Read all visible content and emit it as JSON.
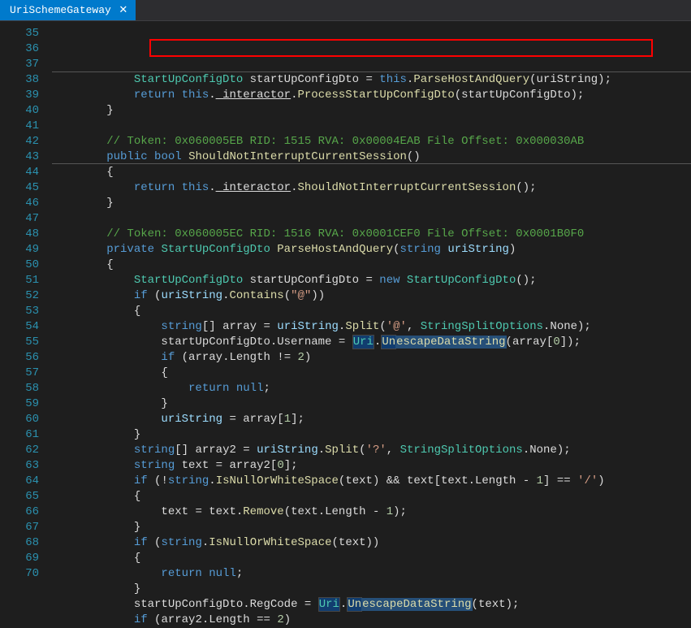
{
  "tab": {
    "title": "UriSchemeGateway",
    "close_glyph": "✕"
  },
  "lines": [
    {
      "n": 35,
      "segs": [
        {
          "t": "            ",
          "c": ""
        },
        {
          "t": "StartUpConfigDto",
          "c": "type"
        },
        {
          "t": " ",
          "c": ""
        },
        {
          "t": "startUpConfigDto",
          "c": "ident"
        },
        {
          "t": " ",
          "c": ""
        },
        {
          "t": "=",
          "c": "op"
        },
        {
          "t": " ",
          "c": ""
        },
        {
          "t": "this",
          "c": "kw"
        },
        {
          "t": ".",
          "c": "punc"
        },
        {
          "t": "ParseHostAndQuery",
          "c": "method-call"
        },
        {
          "t": "(",
          "c": "punc"
        },
        {
          "t": "uriString",
          "c": "ident"
        },
        {
          "t": ");",
          "c": "punc"
        }
      ]
    },
    {
      "n": 36,
      "segs": [
        {
          "t": "            ",
          "c": ""
        },
        {
          "t": "return",
          "c": "kw"
        },
        {
          "t": " ",
          "c": ""
        },
        {
          "t": "this",
          "c": "kw"
        },
        {
          "t": ".",
          "c": "punc"
        },
        {
          "t": "_interactor",
          "c": "field underline"
        },
        {
          "t": ".",
          "c": "punc"
        },
        {
          "t": "ProcessStartUpConfigDto",
          "c": "method-call"
        },
        {
          "t": "(",
          "c": "punc"
        },
        {
          "t": "startUpConfigDto",
          "c": "ident"
        },
        {
          "t": ");",
          "c": "punc"
        }
      ]
    },
    {
      "n": 37,
      "segs": [
        {
          "t": "        }",
          "c": "punc"
        }
      ]
    },
    {
      "n": 38,
      "segs": []
    },
    {
      "n": 39,
      "segs": [
        {
          "t": "        ",
          "c": ""
        },
        {
          "t": "// Token: 0x060005EB RID: 1515 RVA: 0x00004EAB File Offset: 0x000030AB",
          "c": "comment"
        }
      ]
    },
    {
      "n": 40,
      "segs": [
        {
          "t": "        ",
          "c": ""
        },
        {
          "t": "public",
          "c": "kw"
        },
        {
          "t": " ",
          "c": ""
        },
        {
          "t": "bool",
          "c": "kw"
        },
        {
          "t": " ",
          "c": ""
        },
        {
          "t": "ShouldNotInterruptCurrentSession",
          "c": "method-decl"
        },
        {
          "t": "()",
          "c": "punc"
        }
      ]
    },
    {
      "n": 41,
      "segs": [
        {
          "t": "        {",
          "c": "punc"
        }
      ]
    },
    {
      "n": 42,
      "segs": [
        {
          "t": "            ",
          "c": ""
        },
        {
          "t": "return",
          "c": "kw"
        },
        {
          "t": " ",
          "c": ""
        },
        {
          "t": "this",
          "c": "kw"
        },
        {
          "t": ".",
          "c": "punc"
        },
        {
          "t": "_interactor",
          "c": "field underline"
        },
        {
          "t": ".",
          "c": "punc"
        },
        {
          "t": "ShouldNotInterruptCurrentSession",
          "c": "method-call"
        },
        {
          "t": "();",
          "c": "punc"
        }
      ]
    },
    {
      "n": 43,
      "segs": [
        {
          "t": "        }",
          "c": "punc"
        }
      ]
    },
    {
      "n": 44,
      "segs": []
    },
    {
      "n": 45,
      "segs": [
        {
          "t": "        ",
          "c": ""
        },
        {
          "t": "// Token: 0x060005EC RID: 1516 RVA: 0x0001CEF0 File Offset: 0x0001B0F0",
          "c": "comment"
        }
      ]
    },
    {
      "n": 46,
      "segs": [
        {
          "t": "        ",
          "c": ""
        },
        {
          "t": "private",
          "c": "kw"
        },
        {
          "t": " ",
          "c": ""
        },
        {
          "t": "StartUpConfigDto",
          "c": "type"
        },
        {
          "t": " ",
          "c": ""
        },
        {
          "t": "ParseHostAndQuery",
          "c": "method-decl"
        },
        {
          "t": "(",
          "c": "punc"
        },
        {
          "t": "string",
          "c": "kw"
        },
        {
          "t": " ",
          "c": ""
        },
        {
          "t": "uriString",
          "c": "param"
        },
        {
          "t": ")",
          "c": "punc"
        }
      ]
    },
    {
      "n": 47,
      "segs": [
        {
          "t": "        {",
          "c": "punc"
        }
      ]
    },
    {
      "n": 48,
      "segs": [
        {
          "t": "            ",
          "c": ""
        },
        {
          "t": "StartUpConfigDto",
          "c": "type"
        },
        {
          "t": " ",
          "c": ""
        },
        {
          "t": "startUpConfigDto",
          "c": "ident"
        },
        {
          "t": " ",
          "c": ""
        },
        {
          "t": "=",
          "c": "op"
        },
        {
          "t": " ",
          "c": ""
        },
        {
          "t": "new",
          "c": "kw"
        },
        {
          "t": " ",
          "c": ""
        },
        {
          "t": "StartUpConfigDto",
          "c": "type"
        },
        {
          "t": "();",
          "c": "punc"
        }
      ]
    },
    {
      "n": 49,
      "segs": [
        {
          "t": "            ",
          "c": ""
        },
        {
          "t": "if",
          "c": "kw"
        },
        {
          "t": " (",
          "c": "punc"
        },
        {
          "t": "uriString",
          "c": "param"
        },
        {
          "t": ".",
          "c": "punc"
        },
        {
          "t": "Contains",
          "c": "method-call"
        },
        {
          "t": "(",
          "c": "punc"
        },
        {
          "t": "\"@\"",
          "c": "string"
        },
        {
          "t": "))",
          "c": "punc"
        }
      ]
    },
    {
      "n": 50,
      "segs": [
        {
          "t": "            {",
          "c": "punc"
        }
      ]
    },
    {
      "n": 51,
      "segs": [
        {
          "t": "                ",
          "c": ""
        },
        {
          "t": "string",
          "c": "kw"
        },
        {
          "t": "[] ",
          "c": "punc"
        },
        {
          "t": "array",
          "c": "ident"
        },
        {
          "t": " ",
          "c": ""
        },
        {
          "t": "=",
          "c": "op"
        },
        {
          "t": " ",
          "c": ""
        },
        {
          "t": "uriString",
          "c": "param"
        },
        {
          "t": ".",
          "c": "punc"
        },
        {
          "t": "Split",
          "c": "method-call"
        },
        {
          "t": "(",
          "c": "punc"
        },
        {
          "t": "'@'",
          "c": "string"
        },
        {
          "t": ", ",
          "c": "punc"
        },
        {
          "t": "StringSplitOptions",
          "c": "type"
        },
        {
          "t": ".",
          "c": "punc"
        },
        {
          "t": "None",
          "c": "ident"
        },
        {
          "t": ");",
          "c": "punc"
        }
      ]
    },
    {
      "n": 52,
      "segs": [
        {
          "t": "                ",
          "c": ""
        },
        {
          "t": "startUpConfigDto",
          "c": "ident"
        },
        {
          "t": ".",
          "c": "punc"
        },
        {
          "t": "Username",
          "c": "ident"
        },
        {
          "t": " ",
          "c": ""
        },
        {
          "t": "=",
          "c": "op"
        },
        {
          "t": " ",
          "c": ""
        },
        {
          "t": "Uri",
          "c": "type hl-box"
        },
        {
          "t": ".",
          "c": "punc"
        },
        {
          "t": "Un",
          "c": "method-call hl-box"
        },
        {
          "t": "escapeDataString",
          "c": "method-call sel-highlight"
        },
        {
          "t": "(",
          "c": "punc"
        },
        {
          "t": "array",
          "c": "ident"
        },
        {
          "t": "[",
          "c": "punc"
        },
        {
          "t": "0",
          "c": "num"
        },
        {
          "t": "]);",
          "c": "punc"
        }
      ]
    },
    {
      "n": 53,
      "segs": [
        {
          "t": "                ",
          "c": ""
        },
        {
          "t": "if",
          "c": "kw"
        },
        {
          "t": " (",
          "c": "punc"
        },
        {
          "t": "array",
          "c": "ident"
        },
        {
          "t": ".",
          "c": "punc"
        },
        {
          "t": "Length",
          "c": "ident"
        },
        {
          "t": " ",
          "c": ""
        },
        {
          "t": "!=",
          "c": "op"
        },
        {
          "t": " ",
          "c": ""
        },
        {
          "t": "2",
          "c": "num"
        },
        {
          "t": ")",
          "c": "punc"
        }
      ]
    },
    {
      "n": 54,
      "segs": [
        {
          "t": "                {",
          "c": "punc"
        }
      ]
    },
    {
      "n": 55,
      "segs": [
        {
          "t": "                    ",
          "c": ""
        },
        {
          "t": "return",
          "c": "kw"
        },
        {
          "t": " ",
          "c": ""
        },
        {
          "t": "null",
          "c": "kw"
        },
        {
          "t": ";",
          "c": "punc"
        }
      ]
    },
    {
      "n": 56,
      "segs": [
        {
          "t": "                }",
          "c": "punc"
        }
      ]
    },
    {
      "n": 57,
      "segs": [
        {
          "t": "                ",
          "c": ""
        },
        {
          "t": "uriString",
          "c": "param"
        },
        {
          "t": " ",
          "c": ""
        },
        {
          "t": "=",
          "c": "op"
        },
        {
          "t": " ",
          "c": ""
        },
        {
          "t": "array",
          "c": "ident"
        },
        {
          "t": "[",
          "c": "punc"
        },
        {
          "t": "1",
          "c": "num"
        },
        {
          "t": "];",
          "c": "punc"
        }
      ]
    },
    {
      "n": 58,
      "segs": [
        {
          "t": "            }",
          "c": "punc"
        }
      ]
    },
    {
      "n": 59,
      "segs": [
        {
          "t": "            ",
          "c": ""
        },
        {
          "t": "string",
          "c": "kw"
        },
        {
          "t": "[] ",
          "c": "punc"
        },
        {
          "t": "array2",
          "c": "ident"
        },
        {
          "t": " ",
          "c": ""
        },
        {
          "t": "=",
          "c": "op"
        },
        {
          "t": " ",
          "c": ""
        },
        {
          "t": "uriString",
          "c": "param"
        },
        {
          "t": ".",
          "c": "punc"
        },
        {
          "t": "Split",
          "c": "method-call"
        },
        {
          "t": "(",
          "c": "punc"
        },
        {
          "t": "'?'",
          "c": "string"
        },
        {
          "t": ", ",
          "c": "punc"
        },
        {
          "t": "StringSplitOptions",
          "c": "type"
        },
        {
          "t": ".",
          "c": "punc"
        },
        {
          "t": "None",
          "c": "ident"
        },
        {
          "t": ");",
          "c": "punc"
        }
      ]
    },
    {
      "n": 60,
      "segs": [
        {
          "t": "            ",
          "c": ""
        },
        {
          "t": "string",
          "c": "kw"
        },
        {
          "t": " ",
          "c": ""
        },
        {
          "t": "text",
          "c": "ident"
        },
        {
          "t": " ",
          "c": ""
        },
        {
          "t": "=",
          "c": "op"
        },
        {
          "t": " ",
          "c": ""
        },
        {
          "t": "array2",
          "c": "ident"
        },
        {
          "t": "[",
          "c": "punc"
        },
        {
          "t": "0",
          "c": "num"
        },
        {
          "t": "];",
          "c": "punc"
        }
      ]
    },
    {
      "n": 61,
      "segs": [
        {
          "t": "            ",
          "c": ""
        },
        {
          "t": "if",
          "c": "kw"
        },
        {
          "t": " (!",
          "c": "punc"
        },
        {
          "t": "string",
          "c": "kw"
        },
        {
          "t": ".",
          "c": "punc"
        },
        {
          "t": "IsNullOrWhiteSpace",
          "c": "method-call"
        },
        {
          "t": "(",
          "c": "punc"
        },
        {
          "t": "text",
          "c": "ident"
        },
        {
          "t": ") ",
          "c": "punc"
        },
        {
          "t": "&&",
          "c": "op"
        },
        {
          "t": " ",
          "c": ""
        },
        {
          "t": "text",
          "c": "ident"
        },
        {
          "t": "[",
          "c": "punc"
        },
        {
          "t": "text",
          "c": "ident"
        },
        {
          "t": ".",
          "c": "punc"
        },
        {
          "t": "Length",
          "c": "ident"
        },
        {
          "t": " ",
          "c": ""
        },
        {
          "t": "-",
          "c": "op"
        },
        {
          "t": " ",
          "c": ""
        },
        {
          "t": "1",
          "c": "num"
        },
        {
          "t": "] ",
          "c": "punc"
        },
        {
          "t": "==",
          "c": "op"
        },
        {
          "t": " ",
          "c": ""
        },
        {
          "t": "'/'",
          "c": "string"
        },
        {
          "t": ")",
          "c": "punc"
        }
      ]
    },
    {
      "n": 62,
      "segs": [
        {
          "t": "            {",
          "c": "punc"
        }
      ]
    },
    {
      "n": 63,
      "segs": [
        {
          "t": "                ",
          "c": ""
        },
        {
          "t": "text",
          "c": "ident"
        },
        {
          "t": " ",
          "c": ""
        },
        {
          "t": "=",
          "c": "op"
        },
        {
          "t": " ",
          "c": ""
        },
        {
          "t": "text",
          "c": "ident"
        },
        {
          "t": ".",
          "c": "punc"
        },
        {
          "t": "Remove",
          "c": "method-call"
        },
        {
          "t": "(",
          "c": "punc"
        },
        {
          "t": "text",
          "c": "ident"
        },
        {
          "t": ".",
          "c": "punc"
        },
        {
          "t": "Length",
          "c": "ident"
        },
        {
          "t": " ",
          "c": ""
        },
        {
          "t": "-",
          "c": "op"
        },
        {
          "t": " ",
          "c": ""
        },
        {
          "t": "1",
          "c": "num"
        },
        {
          "t": ");",
          "c": "punc"
        }
      ]
    },
    {
      "n": 64,
      "segs": [
        {
          "t": "            }",
          "c": "punc"
        }
      ]
    },
    {
      "n": 65,
      "segs": [
        {
          "t": "            ",
          "c": ""
        },
        {
          "t": "if",
          "c": "kw"
        },
        {
          "t": " (",
          "c": "punc"
        },
        {
          "t": "string",
          "c": "kw"
        },
        {
          "t": ".",
          "c": "punc"
        },
        {
          "t": "IsNullOrWhiteSpace",
          "c": "method-call"
        },
        {
          "t": "(",
          "c": "punc"
        },
        {
          "t": "text",
          "c": "ident"
        },
        {
          "t": "))",
          "c": "punc"
        }
      ]
    },
    {
      "n": 66,
      "segs": [
        {
          "t": "            {",
          "c": "punc"
        }
      ]
    },
    {
      "n": 67,
      "segs": [
        {
          "t": "                ",
          "c": ""
        },
        {
          "t": "return",
          "c": "kw"
        },
        {
          "t": " ",
          "c": ""
        },
        {
          "t": "null",
          "c": "kw"
        },
        {
          "t": ";",
          "c": "punc"
        }
      ]
    },
    {
      "n": 68,
      "segs": [
        {
          "t": "            }",
          "c": "punc"
        }
      ]
    },
    {
      "n": 69,
      "segs": [
        {
          "t": "            ",
          "c": ""
        },
        {
          "t": "startUpConfigDto",
          "c": "ident"
        },
        {
          "t": ".",
          "c": "punc"
        },
        {
          "t": "RegCode",
          "c": "ident"
        },
        {
          "t": " ",
          "c": ""
        },
        {
          "t": "=",
          "c": "op"
        },
        {
          "t": " ",
          "c": ""
        },
        {
          "t": "Uri",
          "c": "type hl-box"
        },
        {
          "t": ".",
          "c": "punc"
        },
        {
          "t": "Un",
          "c": "method-call hl-box"
        },
        {
          "t": "escapeDataString",
          "c": "method-call sel-highlight"
        },
        {
          "t": "(",
          "c": "punc"
        },
        {
          "t": "text",
          "c": "ident"
        },
        {
          "t": ");",
          "c": "punc"
        }
      ]
    },
    {
      "n": 70,
      "segs": [
        {
          "t": "            ",
          "c": ""
        },
        {
          "t": "if",
          "c": "kw"
        },
        {
          "t": " (",
          "c": "punc"
        },
        {
          "t": "array2",
          "c": "ident"
        },
        {
          "t": ".",
          "c": "punc"
        },
        {
          "t": "Length",
          "c": "ident"
        },
        {
          "t": " ",
          "c": ""
        },
        {
          "t": "==",
          "c": "op"
        },
        {
          "t": " ",
          "c": ""
        },
        {
          "t": "2",
          "c": "num"
        },
        {
          "t": ")",
          "c": "punc"
        }
      ]
    }
  ]
}
